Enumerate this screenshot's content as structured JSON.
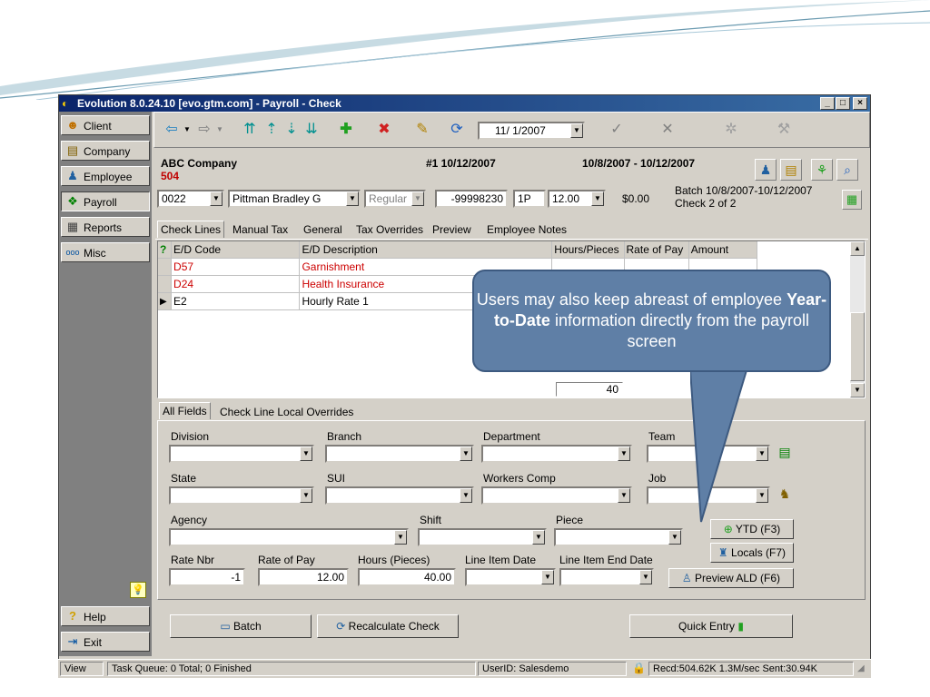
{
  "window": {
    "title": "Evolution 8.0.24.10 [evo.gtm.com] - Payroll - Check",
    "controls": [
      "_",
      "□",
      "×"
    ]
  },
  "nav": {
    "items": [
      {
        "label": "Client",
        "icon": "client-icon"
      },
      {
        "label": "Company",
        "icon": "company-icon"
      },
      {
        "label": "Employee",
        "icon": "employee-icon"
      },
      {
        "label": "Payroll",
        "icon": "payroll-icon"
      },
      {
        "label": "Reports",
        "icon": "reports-icon"
      },
      {
        "label": "Misc",
        "icon": "misc-icon"
      }
    ],
    "help": "Help",
    "exit": "Exit"
  },
  "toolbar": {
    "date": "11/ 1/2007"
  },
  "header": {
    "company": "ABC Company",
    "company_number": "504",
    "check_no": "#1 10/12/2007",
    "period": "10/8/2007 - 10/12/2007",
    "batch": "Batch 10/8/2007-10/12/2007",
    "check_of": "Check 2 of 2",
    "employee_code": "0022",
    "employee_name": "Pittman Bradley G",
    "check_type": "Regular",
    "check_number_field": "-99998230",
    "frequency": "1P",
    "hours": "12.00",
    "amount": "$0.00"
  },
  "tabs": [
    "Check Lines",
    "Manual Tax",
    "General",
    "Tax Overrides",
    "Preview",
    "Employee Notes"
  ],
  "grid": {
    "columns": [
      "E/D Code",
      "E/D Description",
      "Hours/Pieces",
      "Rate of Pay",
      "Amount"
    ],
    "rows": [
      {
        "code": "D57",
        "desc": "Garnishment",
        "hours": "",
        "rate": "",
        "amount": ""
      },
      {
        "code": "D24",
        "desc": "Health Insurance",
        "hours": "",
        "rate": "",
        "amount": ""
      },
      {
        "code": "E2",
        "desc": "Hourly Rate 1",
        "hours": "",
        "rate": "",
        "amount": ""
      }
    ],
    "total_hours": "40"
  },
  "subtabs": [
    "All Fields",
    "Check Line Local Overrides"
  ],
  "fields": {
    "division": "Division",
    "branch": "Branch",
    "department": "Department",
    "team": "Team",
    "state": "State",
    "sui": "SUI",
    "workers_comp": "Workers Comp",
    "job": "Job",
    "agency": "Agency",
    "shift": "Shift",
    "piece": "Piece",
    "rate_nbr": "Rate Nbr",
    "rate_of_pay": "Rate of Pay",
    "hours_pieces": "Hours (Pieces)",
    "line_item_date": "Line Item Date",
    "line_item_end_date": "Line Item End Date",
    "rate_nbr_value": "-1",
    "rate_of_pay_value": "12.00",
    "hours_value": "40.00"
  },
  "side_buttons": {
    "ytd": "YTD (F3)",
    "locals": "Locals (F7)",
    "preview_ald": "Preview ALD (F6)"
  },
  "bottom_buttons": {
    "batch": "Batch",
    "recalculate": "Recalculate Check",
    "quick_entry": "Quick Entry"
  },
  "statusbar": {
    "view": "View",
    "task_queue": "Task Queue: 0 Total; 0 Finished",
    "user": "UserID: Salesdemo",
    "stats": "Recd:504.62K  1.3M/sec  Sent:30.94K"
  },
  "callout": {
    "text_before": "Users may also keep abreast of employee ",
    "text_bold": "Year-to-Date",
    "text_after": " information directly from the payroll screen"
  },
  "colors": {
    "titlebar": "#0a246a",
    "deduction_text": "#cc0000",
    "callout_bg": "#5f7fa6"
  }
}
